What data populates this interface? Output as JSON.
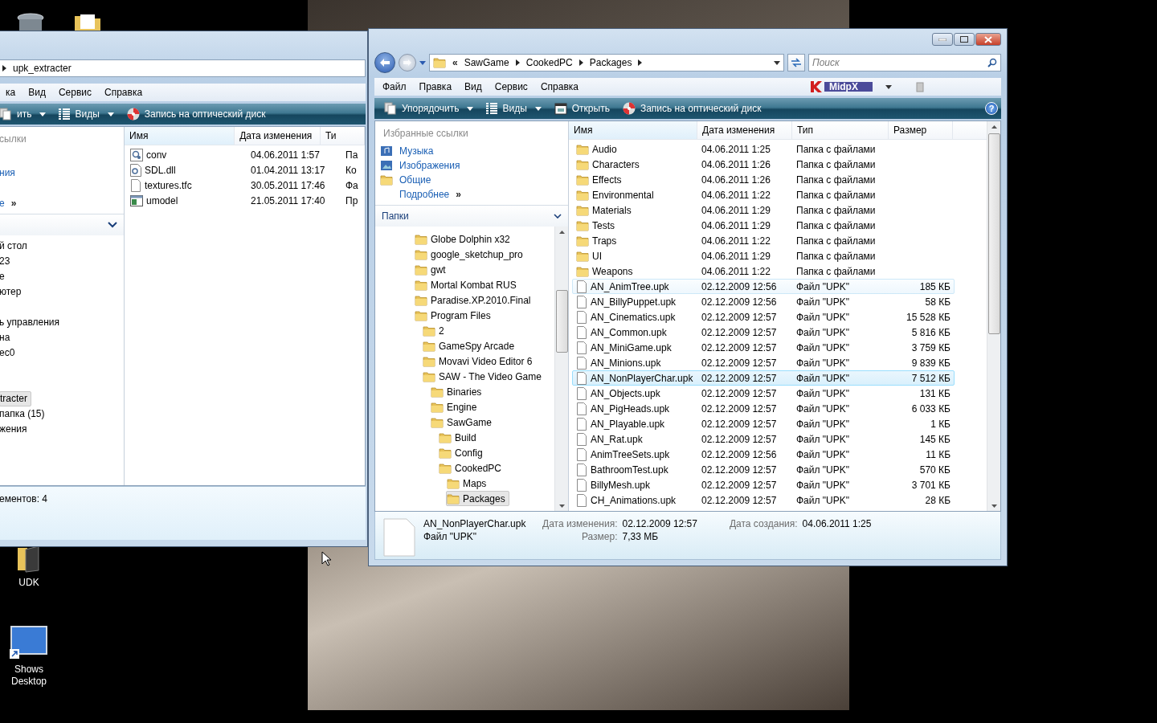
{
  "desktop": {
    "icons": [
      {
        "label": "UDK",
        "kind": "folder"
      },
      {
        "label": "Shows Desktop",
        "kind": "monitor"
      }
    ]
  },
  "left_window": {
    "address": {
      "path": [
        "upk_extracter"
      ]
    },
    "menu": [
      "ка",
      "Вид",
      "Сервис",
      "Справка"
    ],
    "commands": [
      {
        "label": "ить",
        "kind": "organize",
        "dropdown": true
      },
      {
        "label": "Виды",
        "kind": "views",
        "dropdown": true
      },
      {
        "label": "Запись на оптический диск",
        "kind": "burn",
        "dropdown": false
      }
    ],
    "favorites_header": "сылки",
    "links": [
      {
        "label": "ния"
      },
      {
        "label": "е",
        "more": "»"
      }
    ],
    "folders": [
      {
        "kind": "item",
        "label": "й стол",
        "selected": false
      },
      {
        "kind": "item",
        "label": "23",
        "selected": false
      },
      {
        "kind": "item",
        "label": "е",
        "selected": false
      },
      {
        "kind": "item",
        "label": "ютер",
        "selected": false
      },
      {
        "kind": "spacer"
      },
      {
        "kind": "item",
        "label": "ь управления",
        "selected": false
      },
      {
        "kind": "item",
        "label": "на",
        "selected": false
      },
      {
        "kind": "item",
        "label": "ec0",
        "selected": false
      },
      {
        "kind": "spacer"
      },
      {
        "kind": "spacer"
      },
      {
        "kind": "item",
        "label": "tracter",
        "selected": true
      },
      {
        "kind": "item",
        "label": "папка (15)",
        "selected": false
      },
      {
        "kind": "item",
        "label": "жения",
        "selected": false
      }
    ],
    "columns": [
      "Имя",
      "Дата изменения",
      "Ти"
    ],
    "rows": [
      {
        "name": "conv",
        "date": "04.06.2011 1:57",
        "type": "Па",
        "kind": "config"
      },
      {
        "name": "SDL.dll",
        "date": "01.04.2011 13:17",
        "type": "Ко",
        "kind": "dll"
      },
      {
        "name": "textures.tfc",
        "date": "30.05.2011 17:46",
        "type": "Фа",
        "kind": "file"
      },
      {
        "name": "umodel",
        "date": "21.05.2011 17:40",
        "type": "Пр",
        "kind": "app"
      }
    ],
    "status": "ементов: 4"
  },
  "right_window": {
    "address": {
      "overflow": "«",
      "path": [
        "SawGame",
        "CookedPC",
        "Packages"
      ]
    },
    "search": {
      "placeholder": "Поиск"
    },
    "menu": [
      "Файл",
      "Правка",
      "Вид",
      "Сервис",
      "Справка"
    ],
    "addon": {
      "label": "MidpX"
    },
    "commands": [
      {
        "label": "Упорядочить",
        "kind": "organize",
        "dropdown": true
      },
      {
        "label": "Виды",
        "kind": "views",
        "dropdown": true
      },
      {
        "label": "Открыть",
        "kind": "open",
        "dropdown": false
      },
      {
        "label": "Запись на оптический диск",
        "kind": "burn",
        "dropdown": false
      }
    ],
    "help": "?",
    "favorites_header": "Избранные ссылки",
    "links": [
      {
        "label": "Музыка",
        "kind": "music"
      },
      {
        "label": "Изображения",
        "kind": "pictures"
      },
      {
        "label": "Общие",
        "kind": "public"
      }
    ],
    "more": {
      "label": "Подробнее",
      "glyph": "»"
    },
    "folders_header": "Папки",
    "tree": [
      {
        "label": "Globe Dolphin x32",
        "selected": false
      },
      {
        "label": "google_sketchup_pro",
        "selected": false
      },
      {
        "label": "gwt",
        "selected": false
      },
      {
        "label": "Mortal Kombat RUS",
        "selected": false
      },
      {
        "label": "Paradise.XP.2010.Final",
        "selected": false
      },
      {
        "label": "Program Files",
        "selected": false,
        "children": [
          {
            "label": "2",
            "selected": false
          },
          {
            "label": "GameSpy Arcade",
            "selected": false
          },
          {
            "label": "Movavi Video Editor 6",
            "selected": false
          },
          {
            "label": "SAW - The Video Game",
            "selected": false,
            "children": [
              {
                "label": "Binaries",
                "selected": false
              },
              {
                "label": "Engine",
                "selected": false
              },
              {
                "label": "SawGame",
                "selected": false,
                "children": [
                  {
                    "label": "Build",
                    "selected": false
                  },
                  {
                    "label": "Config",
                    "selected": false
                  },
                  {
                    "label": "CookedPC",
                    "selected": false,
                    "children": [
                      {
                        "label": "Maps",
                        "selected": false
                      },
                      {
                        "label": "Packages",
                        "selected": true
                      }
                    ]
                  }
                ]
              }
            ]
          }
        ]
      }
    ],
    "columns": [
      "Имя",
      "Дата изменения",
      "Тип",
      "Размер"
    ],
    "rows": [
      {
        "kind": "folder",
        "name": "Audio",
        "date": "04.06.2011 1:25",
        "type": "Папка с файлами",
        "selected": false,
        "hovered": false
      },
      {
        "kind": "folder",
        "name": "Characters",
        "date": "04.06.2011 1:26",
        "type": "Папка с файлами",
        "selected": false,
        "hovered": false
      },
      {
        "kind": "folder",
        "name": "Effects",
        "date": "04.06.2011 1:26",
        "type": "Папка с файлами",
        "selected": false,
        "hovered": false
      },
      {
        "kind": "folder",
        "name": "Environmental",
        "date": "04.06.2011 1:22",
        "type": "Папка с файлами",
        "selected": false,
        "hovered": false
      },
      {
        "kind": "folder",
        "name": "Materials",
        "date": "04.06.2011 1:29",
        "type": "Папка с файлами",
        "selected": false,
        "hovered": false
      },
      {
        "kind": "folder",
        "name": "Tests",
        "date": "04.06.2011 1:29",
        "type": "Папка с файлами",
        "selected": false,
        "hovered": false
      },
      {
        "kind": "folder",
        "name": "Traps",
        "date": "04.06.2011 1:22",
        "type": "Папка с файлами",
        "selected": false,
        "hovered": false
      },
      {
        "kind": "folder",
        "name": "UI",
        "date": "04.06.2011 1:29",
        "type": "Папка с файлами",
        "selected": false,
        "hovered": false
      },
      {
        "kind": "folder",
        "name": "Weapons",
        "date": "04.06.2011 1:22",
        "type": "Папка с файлами",
        "selected": false,
        "hovered": false
      },
      {
        "kind": "file",
        "name": "AN_AnimTree.upk",
        "date": "02.12.2009 12:56",
        "type": "Файл \"UPK\"",
        "size": "185 КБ",
        "selected": false,
        "hovered": true
      },
      {
        "kind": "file",
        "name": "AN_BillyPuppet.upk",
        "date": "02.12.2009 12:56",
        "type": "Файл \"UPK\"",
        "size": "58 КБ",
        "selected": false,
        "hovered": false
      },
      {
        "kind": "file",
        "name": "AN_Cinematics.upk",
        "date": "02.12.2009 12:57",
        "type": "Файл \"UPK\"",
        "size": "15 528 КБ",
        "selected": false,
        "hovered": false
      },
      {
        "kind": "file",
        "name": "AN_Common.upk",
        "date": "02.12.2009 12:57",
        "type": "Файл \"UPK\"",
        "size": "5 816 КБ",
        "selected": false,
        "hovered": false
      },
      {
        "kind": "file",
        "name": "AN_MiniGame.upk",
        "date": "02.12.2009 12:57",
        "type": "Файл \"UPK\"",
        "size": "3 759 КБ",
        "selected": false,
        "hovered": false
      },
      {
        "kind": "file",
        "name": "AN_Minions.upk",
        "date": "02.12.2009 12:57",
        "type": "Файл \"UPK\"",
        "size": "9 839 КБ",
        "selected": false,
        "hovered": false
      },
      {
        "kind": "file",
        "name": "AN_NonPlayerChar.upk",
        "date": "02.12.2009 12:57",
        "type": "Файл \"UPK\"",
        "size": "7 512 КБ",
        "selected": true,
        "hovered": false
      },
      {
        "kind": "file",
        "name": "AN_Objects.upk",
        "date": "02.12.2009 12:57",
        "type": "Файл \"UPK\"",
        "size": "131 КБ",
        "selected": false,
        "hovered": false
      },
      {
        "kind": "file",
        "name": "AN_PigHeads.upk",
        "date": "02.12.2009 12:57",
        "type": "Файл \"UPK\"",
        "size": "6 033 КБ",
        "selected": false,
        "hovered": false
      },
      {
        "kind": "file",
        "name": "AN_Playable.upk",
        "date": "02.12.2009 12:57",
        "type": "Файл \"UPK\"",
        "size": "1 КБ",
        "selected": false,
        "hovered": false
      },
      {
        "kind": "file",
        "name": "AN_Rat.upk",
        "date": "02.12.2009 12:57",
        "type": "Файл \"UPK\"",
        "size": "145 КБ",
        "selected": false,
        "hovered": false
      },
      {
        "kind": "file",
        "name": "AnimTreeSets.upk",
        "date": "02.12.2009 12:56",
        "type": "Файл \"UPK\"",
        "size": "11 КБ",
        "selected": false,
        "hovered": false
      },
      {
        "kind": "file",
        "name": "BathroomTest.upk",
        "date": "02.12.2009 12:57",
        "type": "Файл \"UPK\"",
        "size": "570 КБ",
        "selected": false,
        "hovered": false
      },
      {
        "kind": "file",
        "name": "BillyMesh.upk",
        "date": "02.12.2009 12:57",
        "type": "Файл \"UPK\"",
        "size": "3 701 КБ",
        "selected": false,
        "hovered": false
      },
      {
        "kind": "file",
        "name": "CH_Animations.upk",
        "date": "02.12.2009 12:57",
        "type": "Файл \"UPK\"",
        "size": "28 КБ",
        "selected": false,
        "hovered": false
      }
    ],
    "details": {
      "name": "AN_NonPlayerChar.upk",
      "type": "Файл \"UPK\"",
      "columns": [
        [
          {
            "label": "Дата изменения:",
            "value": "02.12.2009 12:57"
          },
          {
            "label": "Размер:",
            "value": "7,33 МБ"
          }
        ],
        [
          {
            "label": "Дата создания:",
            "value": "04.06.2011 1:25"
          }
        ]
      ]
    }
  }
}
